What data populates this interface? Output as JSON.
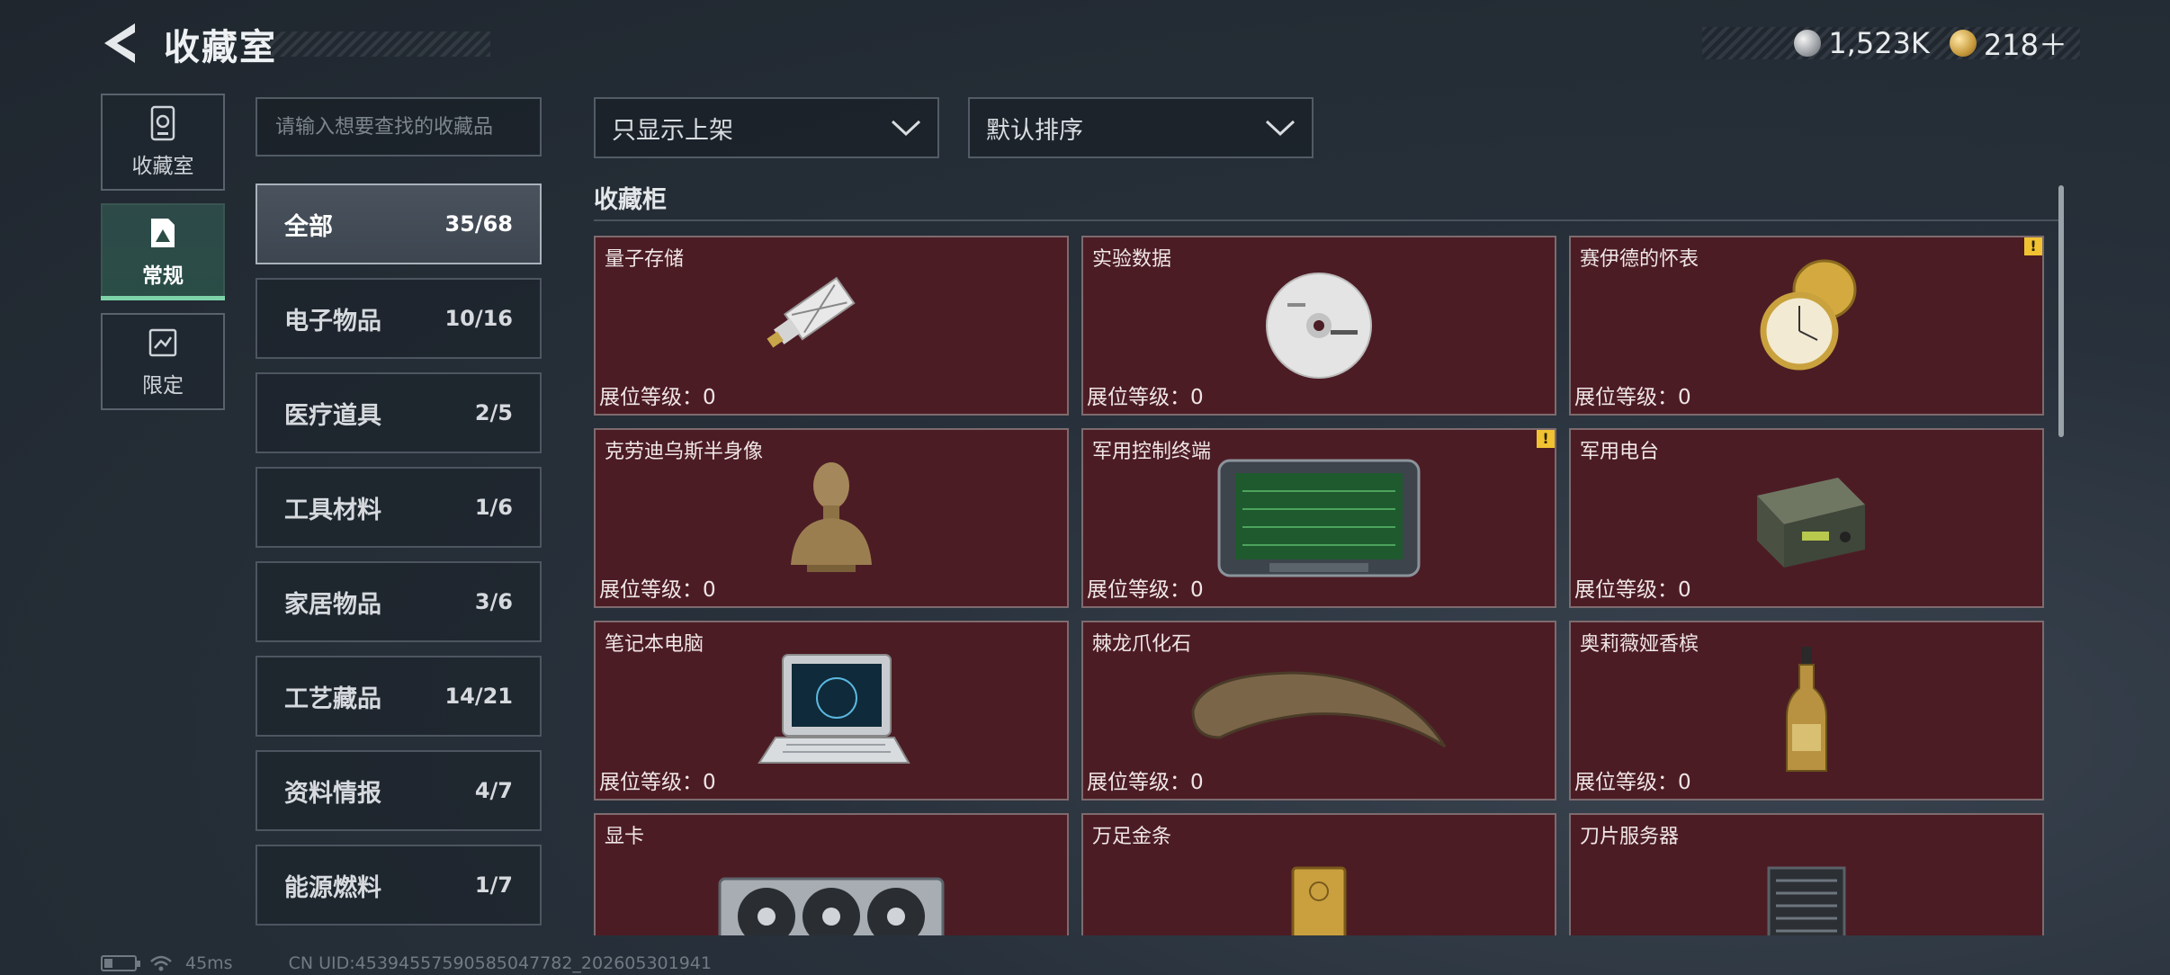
{
  "header": {
    "title": "收藏室",
    "currency": [
      {
        "icon": "silver-coin-icon",
        "value": "1,523K"
      },
      {
        "icon": "gold-coin-icon",
        "value": "218＋"
      }
    ]
  },
  "sidenav": {
    "items": [
      {
        "label": "收藏室",
        "icon": "locker-icon",
        "active": false
      },
      {
        "label": "常规",
        "icon": "collection-icon",
        "active": true
      },
      {
        "label": "限定",
        "icon": "limited-icon",
        "active": false
      }
    ]
  },
  "search": {
    "placeholder": "请输入想要查找的收藏品"
  },
  "categories": [
    {
      "name": "全部",
      "count": "35/68",
      "active": true
    },
    {
      "name": "电子物品",
      "count": "10/16"
    },
    {
      "name": "医疗道具",
      "count": "2/5"
    },
    {
      "name": "工具材料",
      "count": "1/6"
    },
    {
      "name": "家居物品",
      "count": "3/6"
    },
    {
      "name": "工艺藏品",
      "count": "14/21"
    },
    {
      "name": "资料情报",
      "count": "4/7"
    },
    {
      "name": "能源燃料",
      "count": "1/7"
    }
  ],
  "filters": {
    "display": "只显示上架",
    "sort": "默认排序"
  },
  "section_title": "收藏柜",
  "items": [
    {
      "name": "量子存储",
      "level": "展位等级：0",
      "icon": "usb-drive-icon"
    },
    {
      "name": "实验数据",
      "level": "展位等级：0",
      "icon": "disc-icon"
    },
    {
      "name": "赛伊德的怀表",
      "level": "展位等级：0",
      "icon": "pocket-watch-icon",
      "warning": "!"
    },
    {
      "name": "克劳迪乌斯半身像",
      "level": "展位等级：0",
      "icon": "bust-icon"
    },
    {
      "name": "军用控制终端",
      "level": "展位等级：0",
      "icon": "terminal-icon",
      "warning": "!"
    },
    {
      "name": "军用电台",
      "level": "展位等级：0",
      "icon": "radio-icon"
    },
    {
      "name": "笔记本电脑",
      "level": "展位等级：0",
      "icon": "laptop-icon"
    },
    {
      "name": "棘龙爪化石",
      "level": "展位等级：0",
      "icon": "claw-fossil-icon"
    },
    {
      "name": "奥莉薇娅香槟",
      "level": "展位等级：0",
      "icon": "champagne-icon"
    },
    {
      "name": "显卡",
      "level": "",
      "icon": "gpu-icon"
    },
    {
      "name": "万足金条",
      "level": "",
      "icon": "gold-bar-icon"
    },
    {
      "name": "刀片服务器",
      "level": "",
      "icon": "server-icon"
    }
  ],
  "status": {
    "ping": "45ms",
    "uid": "CN UID:4539455759058504778​2_202605301941"
  },
  "colors": {
    "card_bg": "#4c1c24",
    "active_tab": "#2a4d46",
    "active_indicator": "#7dd3a8",
    "warning": "#f1c232"
  }
}
